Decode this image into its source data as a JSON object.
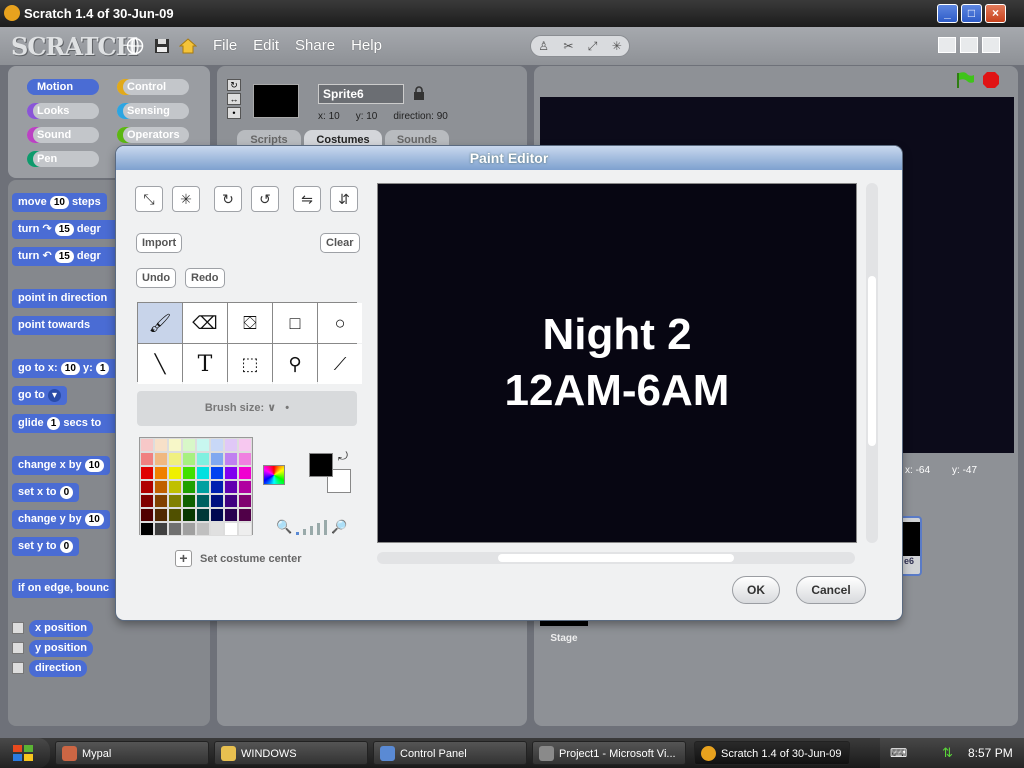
{
  "window": {
    "title": "Scratch 1.4 of 30-Jun-09",
    "min": "_",
    "max": "□",
    "close": "×"
  },
  "menu": {
    "logo": "SCRATCH",
    "items": [
      "File",
      "Edit",
      "Share",
      "Help"
    ]
  },
  "categories": [
    "Motion",
    "Control",
    "Looks",
    "Sensing",
    "Sound",
    "Operators",
    "Pen"
  ],
  "category_colors": {
    "motion": "#4a6cd4",
    "control": "#e1a91a",
    "looks": "#8a55d7",
    "sensing": "#2ca5e2",
    "sound": "#bb42c3",
    "operators": "#5cb712",
    "pen": "#0e9a6c"
  },
  "blocks": {
    "move": "move",
    "move_n": "10",
    "move_after": "steps",
    "turn1": "turn",
    "turn1_n": "15",
    "turn1_after": "degr",
    "turn2": "turn",
    "turn2_n": "15",
    "turn2_after": "degr",
    "point_dir": "point in direction",
    "point_towards": "point towards",
    "goto": "go to x:",
    "goto_x": "10",
    "goto_y_label": "y:",
    "goto_y": "1",
    "goto_sprite": "go to",
    "glide": "glide",
    "glide_n": "1",
    "glide_after": "secs to",
    "change_x": "change x by",
    "change_x_n": "10",
    "set_x": "set x to",
    "set_x_n": "0",
    "change_y": "change y by",
    "change_y_n": "10",
    "set_y": "set y to",
    "set_y_n": "0",
    "bounce": "if on edge, bounc",
    "xpos": "x position",
    "ypos": "y position",
    "direction": "direction"
  },
  "sprite": {
    "name": "Sprite6",
    "x_label": "x:",
    "x": "10",
    "y_label": "y:",
    "y": "10",
    "dir_label": "direction:",
    "dir": "90"
  },
  "tabs": {
    "scripts": "Scripts",
    "costumes": "Costumes",
    "sounds": "Sounds"
  },
  "stage": {
    "x_label": "x:",
    "x": "-64",
    "y_label": "y:",
    "y": "-47",
    "label": "Stage",
    "sprite_tile": "e6"
  },
  "paint": {
    "title": "Paint Editor",
    "import": "Import",
    "clear": "Clear",
    "undo": "Undo",
    "redo": "Redo",
    "brush_label": "Brush size:",
    "set_center": "Set costume center",
    "ok": "OK",
    "cancel": "Cancel",
    "canvas_line1": "Night 2",
    "canvas_line2": "12AM-6AM"
  },
  "palette": [
    "#f7c8c8",
    "#f7e0c8",
    "#f7f7c8",
    "#d8f7c8",
    "#c8f7f0",
    "#c8d8f7",
    "#e0c8f7",
    "#f7c8f0",
    "#f08080",
    "#f0b880",
    "#f0f080",
    "#a8f080",
    "#80f0e0",
    "#80a8f0",
    "#c080f0",
    "#f080e0",
    "#e00000",
    "#f08000",
    "#f0f000",
    "#40e000",
    "#00e0e0",
    "#0040f0",
    "#8000f0",
    "#f000d0",
    "#b00000",
    "#c06000",
    "#c0c000",
    "#20a000",
    "#00a0a0",
    "#0020b0",
    "#6000b0",
    "#b000a0",
    "#800000",
    "#804000",
    "#808000",
    "#106000",
    "#006060",
    "#001080",
    "#400080",
    "#800070",
    "#500000",
    "#502800",
    "#505000",
    "#083800",
    "#003838",
    "#000850",
    "#280050",
    "#500048",
    "#000000",
    "#404040",
    "#707070",
    "#a0a0a0",
    "#c0c0c0",
    "#e0e0e0",
    "#ffffff",
    "#eeeeee"
  ],
  "taskbar": {
    "tasks": [
      "Mypal",
      "WINDOWS",
      "Control Panel",
      "Project1 - Microsoft Vi...",
      "Scratch 1.4 of 30-Jun-09"
    ],
    "clock": "8:57 PM"
  }
}
